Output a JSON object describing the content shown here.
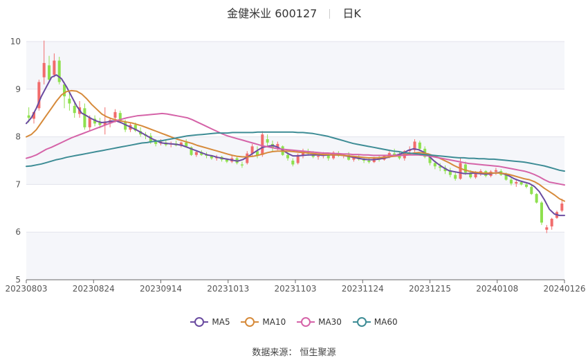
{
  "header": {
    "title": "金健米业 600127",
    "period": "日K"
  },
  "source": "数据来源： 恒生聚源",
  "colors": {
    "up": "#f16c6c",
    "down": "#8ee04e",
    "MA5": "#6a4ba0",
    "MA10": "#d68a3a",
    "MA30": "#d563a8",
    "MA60": "#3d8c95",
    "grid": "#e3e3ec",
    "band": "#f5f6fa"
  },
  "chart_data": {
    "type": "candlestick",
    "ylim": [
      5,
      10
    ],
    "yticks": [
      "5",
      "6",
      "7",
      "8",
      "9",
      "10"
    ],
    "xticks": [
      "20230803",
      "20230824",
      "20230914",
      "20231013",
      "20231103",
      "20231124",
      "20231215",
      "20240108",
      "20240126"
    ],
    "candles_note": "open, high, low, close per trading day (approximate)",
    "candles": [
      [
        8.45,
        8.62,
        8.3,
        8.4
      ],
      [
        8.38,
        8.5,
        8.28,
        8.52
      ],
      [
        8.6,
        9.2,
        8.55,
        9.15
      ],
      [
        9.25,
        10.02,
        9.1,
        9.55
      ],
      [
        9.5,
        9.7,
        9.15,
        9.2
      ],
      [
        9.3,
        9.75,
        9.25,
        9.6
      ],
      [
        9.6,
        9.68,
        9.1,
        9.15
      ],
      [
        9.1,
        9.15,
        8.6,
        8.85
      ],
      [
        8.8,
        8.95,
        8.55,
        8.7
      ],
      [
        8.65,
        8.72,
        8.4,
        8.5
      ],
      [
        8.48,
        8.75,
        8.4,
        8.62
      ],
      [
        8.6,
        8.7,
        8.15,
        8.2
      ],
      [
        8.2,
        8.45,
        8.12,
        8.4
      ],
      [
        8.38,
        8.45,
        8.22,
        8.28
      ],
      [
        8.3,
        8.4,
        8.18,
        8.25
      ],
      [
        8.25,
        8.62,
        8.05,
        8.3
      ],
      [
        8.3,
        8.4,
        8.2,
        8.35
      ],
      [
        8.4,
        8.58,
        8.3,
        8.52
      ],
      [
        8.5,
        8.55,
        8.3,
        8.33
      ],
      [
        8.32,
        8.36,
        8.1,
        8.15
      ],
      [
        8.15,
        8.3,
        8.1,
        8.25
      ],
      [
        8.25,
        8.3,
        8.1,
        8.13
      ],
      [
        8.12,
        8.2,
        8.0,
        8.05
      ],
      [
        8.05,
        8.1,
        7.95,
        8.02
      ],
      [
        8.02,
        8.08,
        7.85,
        7.9
      ],
      [
        7.9,
        7.95,
        7.8,
        7.85
      ],
      [
        7.86,
        7.95,
        7.82,
        7.9
      ],
      [
        7.88,
        7.92,
        7.8,
        7.83
      ],
      [
        7.84,
        7.9,
        7.78,
        7.86
      ],
      [
        7.86,
        7.92,
        7.8,
        7.82
      ],
      [
        7.82,
        7.9,
        7.78,
        7.88
      ],
      [
        7.88,
        7.95,
        7.78,
        7.8
      ],
      [
        7.78,
        7.8,
        7.6,
        7.62
      ],
      [
        7.62,
        7.72,
        7.58,
        7.68
      ],
      [
        7.68,
        7.72,
        7.6,
        7.62
      ],
      [
        7.62,
        7.68,
        7.55,
        7.6
      ],
      [
        7.6,
        7.62,
        7.52,
        7.55
      ],
      [
        7.55,
        7.62,
        7.5,
        7.58
      ],
      [
        7.58,
        7.6,
        7.48,
        7.52
      ],
      [
        7.52,
        7.55,
        7.45,
        7.48
      ],
      [
        7.48,
        7.6,
        7.45,
        7.55
      ],
      [
        7.55,
        7.58,
        7.42,
        7.45
      ],
      [
        7.42,
        7.48,
        7.35,
        7.4
      ],
      [
        7.45,
        7.7,
        7.42,
        7.65
      ],
      [
        7.65,
        7.85,
        7.6,
        7.8
      ],
      [
        7.7,
        7.8,
        7.55,
        7.6
      ],
      [
        7.62,
        8.12,
        7.58,
        8.05
      ],
      [
        7.95,
        8.05,
        7.8,
        7.88
      ],
      [
        7.85,
        7.92,
        7.7,
        7.78
      ],
      [
        7.78,
        7.9,
        7.72,
        7.85
      ],
      [
        7.8,
        7.82,
        7.6,
        7.62
      ],
      [
        7.62,
        7.68,
        7.5,
        7.55
      ],
      [
        7.5,
        7.55,
        7.38,
        7.42
      ],
      [
        7.45,
        7.65,
        7.42,
        7.62
      ],
      [
        7.6,
        7.75,
        7.55,
        7.7
      ],
      [
        7.7,
        7.75,
        7.6,
        7.65
      ],
      [
        7.62,
        7.7,
        7.55,
        7.58
      ],
      [
        7.58,
        7.65,
        7.52,
        7.6
      ],
      [
        7.6,
        7.68,
        7.55,
        7.63
      ],
      [
        7.62,
        7.66,
        7.5,
        7.55
      ],
      [
        7.55,
        7.7,
        7.52,
        7.67
      ],
      [
        7.65,
        7.7,
        7.58,
        7.6
      ],
      [
        7.6,
        7.65,
        7.55,
        7.62
      ],
      [
        7.62,
        7.68,
        7.5,
        7.52
      ],
      [
        7.52,
        7.6,
        7.48,
        7.58
      ],
      [
        7.58,
        7.62,
        7.5,
        7.53
      ],
      [
        7.53,
        7.58,
        7.45,
        7.5
      ],
      [
        7.5,
        7.56,
        7.44,
        7.47
      ],
      [
        7.47,
        7.58,
        7.45,
        7.55
      ],
      [
        7.55,
        7.6,
        7.48,
        7.52
      ],
      [
        7.52,
        7.62,
        7.5,
        7.6
      ],
      [
        7.58,
        7.7,
        7.55,
        7.66
      ],
      [
        7.65,
        7.75,
        7.6,
        7.62
      ],
      [
        7.6,
        7.68,
        7.52,
        7.55
      ],
      [
        7.55,
        7.72,
        7.5,
        7.7
      ],
      [
        7.7,
        7.8,
        7.65,
        7.72
      ],
      [
        7.72,
        7.95,
        7.68,
        7.9
      ],
      [
        7.88,
        7.92,
        7.7,
        7.75
      ],
      [
        7.75,
        7.8,
        7.55,
        7.58
      ],
      [
        7.58,
        7.62,
        7.4,
        7.45
      ],
      [
        7.45,
        7.5,
        7.32,
        7.38
      ],
      [
        7.38,
        7.45,
        7.28,
        7.35
      ],
      [
        7.35,
        7.4,
        7.22,
        7.28
      ],
      [
        7.28,
        7.35,
        7.15,
        7.2
      ],
      [
        7.2,
        7.25,
        7.08,
        7.12
      ],
      [
        7.12,
        7.55,
        7.1,
        7.45
      ],
      [
        7.42,
        7.48,
        7.2,
        7.25
      ],
      [
        7.25,
        7.3,
        7.12,
        7.15
      ],
      [
        7.15,
        7.28,
        7.12,
        7.25
      ],
      [
        7.25,
        7.32,
        7.18,
        7.28
      ],
      [
        7.28,
        7.3,
        7.15,
        7.18
      ],
      [
        7.18,
        7.3,
        7.15,
        7.27
      ],
      [
        7.27,
        7.35,
        7.2,
        7.3
      ],
      [
        7.28,
        7.32,
        7.18,
        7.2
      ],
      [
        7.2,
        7.25,
        7.08,
        7.1
      ],
      [
        7.1,
        7.15,
        6.98,
        7.02
      ],
      [
        7.02,
        7.1,
        6.95,
        7.05
      ],
      [
        7.05,
        7.08,
        6.98,
        7.0
      ],
      [
        7.0,
        7.05,
        6.92,
        6.95
      ],
      [
        6.95,
        6.98,
        6.78,
        6.8
      ],
      [
        6.8,
        6.82,
        6.6,
        6.62
      ],
      [
        6.62,
        6.65,
        6.15,
        6.2
      ],
      [
        6.05,
        6.15,
        5.98,
        6.1
      ],
      [
        6.12,
        6.3,
        6.05,
        6.28
      ],
      [
        6.3,
        6.45,
        6.28,
        6.42
      ],
      [
        6.45,
        6.7,
        6.42,
        6.6
      ]
    ],
    "series": [
      {
        "name": "MA5",
        "values": [
          8.28,
          8.4,
          8.6,
          8.85,
          9.05,
          9.25,
          9.3,
          9.22,
          9.05,
          8.85,
          8.65,
          8.5,
          8.44,
          8.38,
          8.33,
          8.3,
          8.31,
          8.33,
          8.33,
          8.29,
          8.24,
          8.19,
          8.14,
          8.08,
          8.02,
          7.96,
          7.91,
          7.87,
          7.86,
          7.85,
          7.84,
          7.82,
          7.78,
          7.74,
          7.7,
          7.66,
          7.62,
          7.6,
          7.57,
          7.55,
          7.53,
          7.51,
          7.49,
          7.52,
          7.58,
          7.65,
          7.72,
          7.78,
          7.8,
          7.82,
          7.78,
          7.72,
          7.65,
          7.6,
          7.6,
          7.61,
          7.62,
          7.62,
          7.62,
          7.61,
          7.62,
          7.62,
          7.62,
          7.61,
          7.59,
          7.57,
          7.55,
          7.53,
          7.52,
          7.52,
          7.53,
          7.55,
          7.57,
          7.6,
          7.63,
          7.66,
          7.72,
          7.75,
          7.73,
          7.68,
          7.6,
          7.5,
          7.42,
          7.35,
          7.29,
          7.27,
          7.25,
          7.23,
          7.23,
          7.24,
          7.23,
          7.22,
          7.22,
          7.24,
          7.25,
          7.22,
          7.18,
          7.12,
          7.08,
          7.05,
          7.02,
          6.96,
          6.85,
          6.68,
          6.48,
          6.38,
          6.35,
          6.35
        ]
      },
      {
        "name": "MA10",
        "values": [
          8.0,
          8.05,
          8.15,
          8.3,
          8.45,
          8.6,
          8.75,
          8.88,
          8.95,
          8.97,
          8.96,
          8.9,
          8.8,
          8.68,
          8.58,
          8.48,
          8.42,
          8.38,
          8.35,
          8.33,
          8.31,
          8.29,
          8.26,
          8.23,
          8.19,
          8.15,
          8.11,
          8.07,
          8.03,
          7.99,
          7.95,
          7.92,
          7.89,
          7.86,
          7.82,
          7.79,
          7.76,
          7.73,
          7.7,
          7.67,
          7.64,
          7.61,
          7.59,
          7.58,
          7.58,
          7.59,
          7.61,
          7.64,
          7.67,
          7.69,
          7.7,
          7.7,
          7.7,
          7.69,
          7.68,
          7.67,
          7.66,
          7.65,
          7.64,
          7.63,
          7.63,
          7.62,
          7.62,
          7.61,
          7.6,
          7.59,
          7.58,
          7.57,
          7.56,
          7.56,
          7.56,
          7.57,
          7.58,
          7.59,
          7.6,
          7.62,
          7.64,
          7.66,
          7.67,
          7.66,
          7.64,
          7.6,
          7.56,
          7.51,
          7.46,
          7.4,
          7.35,
          7.31,
          7.28,
          7.26,
          7.25,
          7.24,
          7.24,
          7.24,
          7.24,
          7.23,
          7.21,
          7.18,
          7.15,
          7.12,
          7.1,
          7.06,
          7.0,
          6.92,
          6.85,
          6.78,
          6.7,
          6.65
        ]
      },
      {
        "name": "MA30",
        "values": [
          7.55,
          7.58,
          7.62,
          7.68,
          7.74,
          7.78,
          7.83,
          7.88,
          7.93,
          7.98,
          8.02,
          8.06,
          8.1,
          8.14,
          8.18,
          8.22,
          8.26,
          8.3,
          8.34,
          8.37,
          8.4,
          8.42,
          8.44,
          8.45,
          8.46,
          8.47,
          8.48,
          8.49,
          8.48,
          8.46,
          8.44,
          8.42,
          8.4,
          8.36,
          8.31,
          8.26,
          8.21,
          8.16,
          8.11,
          8.06,
          8.02,
          7.99,
          7.96,
          7.93,
          7.9,
          7.87,
          7.84,
          7.81,
          7.79,
          7.77,
          7.75,
          7.74,
          7.73,
          7.72,
          7.71,
          7.7,
          7.69,
          7.68,
          7.67,
          7.66,
          7.66,
          7.65,
          7.65,
          7.64,
          7.64,
          7.63,
          7.63,
          7.62,
          7.62,
          7.61,
          7.61,
          7.61,
          7.61,
          7.61,
          7.61,
          7.61,
          7.62,
          7.62,
          7.62,
          7.61,
          7.6,
          7.58,
          7.56,
          7.54,
          7.52,
          7.5,
          7.48,
          7.46,
          7.44,
          7.43,
          7.42,
          7.41,
          7.4,
          7.39,
          7.38,
          7.36,
          7.34,
          7.32,
          7.3,
          7.28,
          7.25,
          7.21,
          7.16,
          7.1,
          7.05,
          7.03,
          7.01,
          6.99
        ]
      },
      {
        "name": "MA60",
        "values": [
          7.38,
          7.39,
          7.41,
          7.43,
          7.46,
          7.49,
          7.52,
          7.54,
          7.57,
          7.59,
          7.61,
          7.63,
          7.65,
          7.67,
          7.69,
          7.71,
          7.73,
          7.75,
          7.77,
          7.79,
          7.81,
          7.83,
          7.85,
          7.87,
          7.88,
          7.9,
          7.91,
          7.92,
          7.94,
          7.96,
          7.98,
          8.0,
          8.02,
          8.03,
          8.04,
          8.05,
          8.06,
          8.07,
          8.08,
          8.08,
          8.08,
          8.09,
          8.09,
          8.09,
          8.09,
          8.09,
          8.1,
          8.1,
          8.1,
          8.1,
          8.1,
          8.1,
          8.1,
          8.1,
          8.09,
          8.09,
          8.08,
          8.07,
          8.05,
          8.03,
          8.01,
          7.98,
          7.95,
          7.92,
          7.89,
          7.86,
          7.84,
          7.82,
          7.8,
          7.78,
          7.76,
          7.74,
          7.72,
          7.7,
          7.69,
          7.67,
          7.66,
          7.65,
          7.64,
          7.63,
          7.62,
          7.61,
          7.6,
          7.59,
          7.58,
          7.57,
          7.56,
          7.56,
          7.55,
          7.55,
          7.54,
          7.54,
          7.53,
          7.53,
          7.52,
          7.51,
          7.5,
          7.49,
          7.48,
          7.47,
          7.45,
          7.43,
          7.41,
          7.39,
          7.36,
          7.33,
          7.3,
          7.28
        ]
      }
    ]
  },
  "legend": [
    {
      "label": "MA5",
      "key": "MA5"
    },
    {
      "label": "MA10",
      "key": "MA10"
    },
    {
      "label": "MA30",
      "key": "MA30"
    },
    {
      "label": "MA60",
      "key": "MA60"
    }
  ]
}
